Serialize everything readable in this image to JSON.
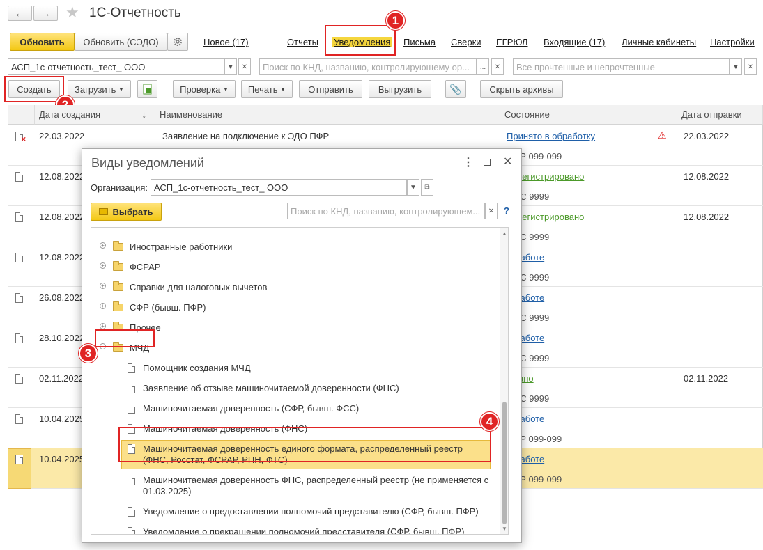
{
  "window": {
    "title": "1С-Отчетность",
    "back_icon": "arrow-left",
    "forward_icon": "arrow-right",
    "star_icon": "star"
  },
  "toolbar_top": {
    "refresh": "Обновить",
    "refresh_sedo": "Обновить (СЭДО)",
    "links": [
      "Новое (17)",
      "Отчеты",
      "Уведомления",
      "Письма",
      "Сверки",
      "ЕГРЮЛ",
      "Входящие (17)",
      "Личные кабинеты",
      "Настройки"
    ]
  },
  "filters": {
    "org_value": "АСП_1с-отчетность_тест_ ООО",
    "search_placeholder": "Поиск по КНД, названию, контролирующему ор...",
    "status_placeholder": "Все прочтенные и непрочтенные"
  },
  "toolbar2": {
    "create": "Создать",
    "load": "Загрузить",
    "check": "Проверка",
    "print": "Печать",
    "send": "Отправить",
    "unload": "Выгрузить",
    "hide_archives": "Скрыть архивы"
  },
  "table": {
    "headers": {
      "date_created": "Дата создания",
      "name": "Наименование",
      "status": "Состояние",
      "date_sent": "Дата отправки"
    },
    "sort_icon": "↓",
    "rows": [
      {
        "date": "22.03.2022",
        "name": "Заявление на подключение к ЭДО ПФР",
        "status": "Принято в обработку",
        "sub": "ПФР 099-099",
        "sent": "22.03.2022"
      },
      {
        "date": "12.08.2022",
        "name": "",
        "status": "Зарегистрировано",
        "sub": "ФСС 9999",
        "sent": "12.08.2022"
      },
      {
        "date": "12.08.2022",
        "name": "",
        "status": "Зарегистрировано",
        "sub": "ФСС 9999",
        "sent": "12.08.2022"
      },
      {
        "date": "12.08.2022",
        "name": "",
        "status": "В работе",
        "sub": "ФСС 9999",
        "sent": ""
      },
      {
        "date": "26.08.2022",
        "name": "",
        "status": "В работе",
        "sub": "ФСС 9999",
        "sent": ""
      },
      {
        "date": "28.10.2022",
        "name": "",
        "status": "В работе",
        "sub": "ФСС 9999",
        "sent": ""
      },
      {
        "date": "02.11.2022",
        "name": "",
        "status": "Сдано",
        "sub": "ФСС 9999",
        "sent": "02.11.2022"
      },
      {
        "date": "10.04.2025",
        "name": "",
        "status": "В работе",
        "sub": "ПФР 099-099",
        "sent": ""
      },
      {
        "date": "10.04.2025",
        "name": "",
        "status": "В работе",
        "sub": "ПФР 099-099",
        "sent": ""
      }
    ]
  },
  "dialog": {
    "title": "Виды уведомлений",
    "org_label": "Организация:",
    "org_value": "АСП_1с-отчетность_тест_ ООО",
    "select_button": "Выбрать",
    "search_placeholder": "Поиск по КНД, названию, контролирующем...",
    "help": "?",
    "folders": [
      "Иностранные работники",
      "ФСРАР",
      "Справки для налоговых вычетов",
      "СФР (бывш. ПФР)",
      "Прочее",
      "МЧД"
    ],
    "items": [
      "Помощник создания МЧД",
      "Заявление об отзыве машиночитаемой доверенности (ФНС)",
      "Машиночитаемая доверенность (СФР, бывш. ФСС)",
      "Машиночитаемая доверенность (ФНС)",
      "Машиночитаемая доверенность единого формата, распределенный реестр (ФНС, Росстат, ФСРАР, РПН, ФТС)",
      "Машиночитаемая доверенность ФНС, распределенный реестр (не применяется с 01.03.2025)",
      "Уведомление о предоставлении полномочий представителю (СФР, бывш. ПФР)",
      "Уведомление о прекращении полномочий представителя (СФР, бывш. ПФР)"
    ]
  },
  "annotations": [
    "1",
    "2",
    "3",
    "4"
  ],
  "colors": {
    "accent_yellow": "#f5d63d",
    "highlight_row": "#fbe9a8",
    "annotation_red": "#e02424",
    "link_green": "#4c9a2a",
    "link_blue": "#1f5fa8"
  }
}
